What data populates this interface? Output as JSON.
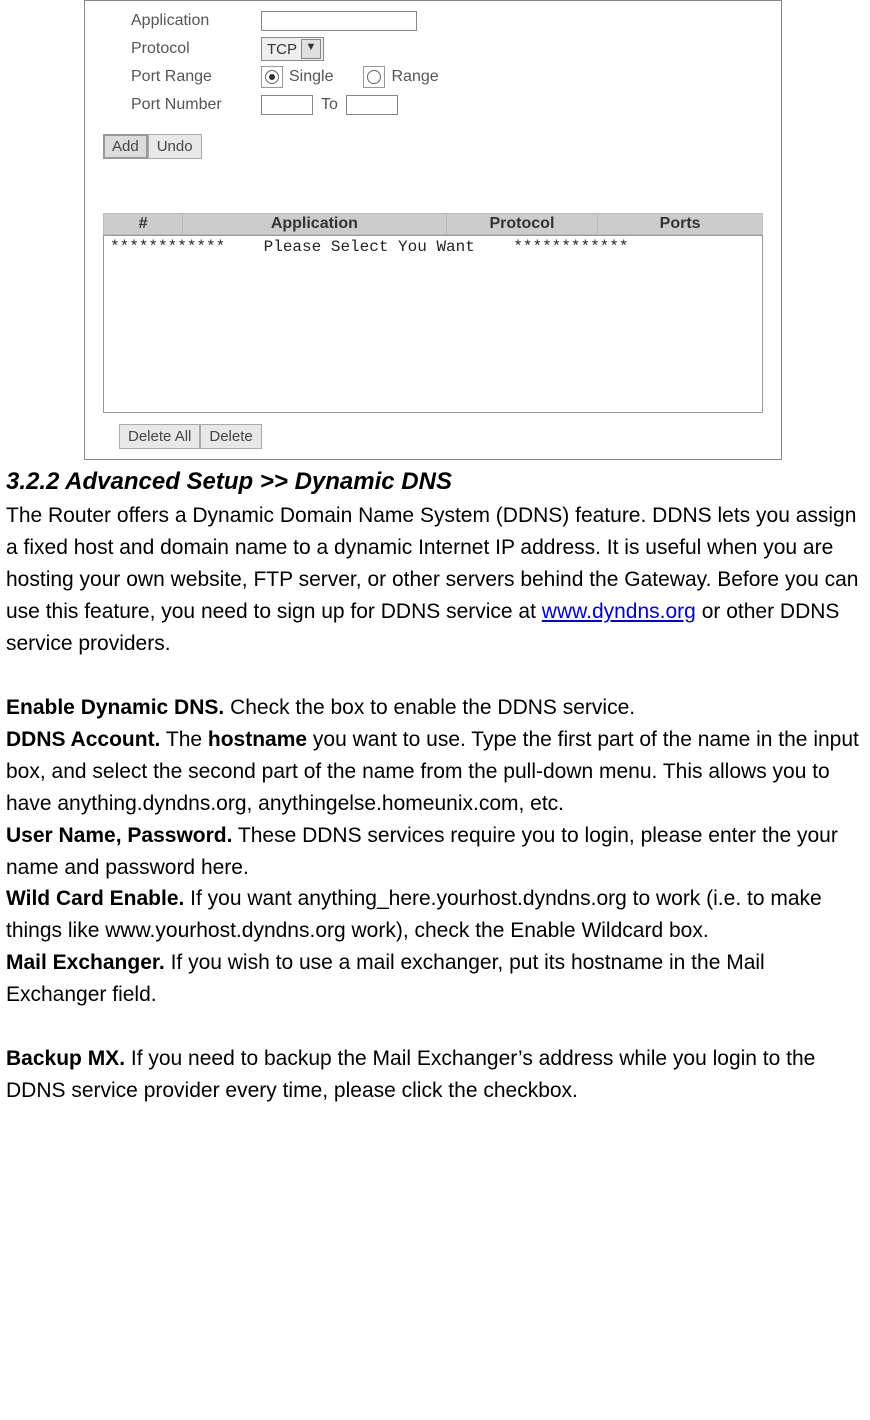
{
  "form": {
    "application_label": "Application",
    "protocol_label": "Protocol",
    "protocol_value": "TCP",
    "port_range_label": "Port Range",
    "single_label": "Single",
    "range_label": "Range",
    "port_number_label": "Port Number",
    "to_label": "To",
    "add_btn": "Add",
    "undo_btn": "Undo",
    "delete_all_btn": "Delete All",
    "delete_btn": "Delete"
  },
  "table": {
    "col_num": "#",
    "col_app": "Application",
    "col_proto": "Protocol",
    "col_ports": "Ports",
    "placeholder_row": "************    Please Select You Want    ************"
  },
  "doc": {
    "section_title": "3.2.2 Advanced Setup >> Dynamic DNS",
    "intro_a": "The Router offers a Dynamic Domain Name System (DDNS) feature. DDNS lets you assign a fixed host and domain name to a dynamic Internet IP address. It is useful when you are hosting your own website, FTP server, or other servers behind the Gateway. Before you can use this feature, you need to sign up for DDNS service at ",
    "intro_link": "www.dyndns.org",
    "intro_b": " or other DDNS service providers.",
    "enable_label": "Enable Dynamic DNS.",
    "enable_text": " Check the box to enable the DDNS service.",
    "ddns_acct_label": "DDNS Account.",
    "ddns_acct_text_a": " The ",
    "ddns_acct_hostname": "hostname",
    "ddns_acct_text_b": " you want to use. Type the first part of the name in the input box, and select the second part of the name from the pull-down menu. This allows you to have anything.dyndns.org, anythingelse.homeunix.com, etc.",
    "user_pass_label": "User Name, Password.",
    "user_pass_text": " These DDNS services require you to login, please enter the your name and password here.",
    "wildcard_label": "Wild Card Enable.",
    "wildcard_text": " If you want anything_here.yourhost.dyndns.org to work (i.e. to make things like www.yourhost.dyndns.org work), check the Enable Wildcard box.",
    "mailx_label": "Mail Exchanger.",
    "mailx_text": " If you wish to use a mail exchanger, put its hostname in the Mail Exchanger field.",
    "backup_label": "Backup MX.",
    "backup_text": " If you need to backup the Mail Exchanger’s address while you login to the DDNS service provider every time, please click the checkbox."
  }
}
